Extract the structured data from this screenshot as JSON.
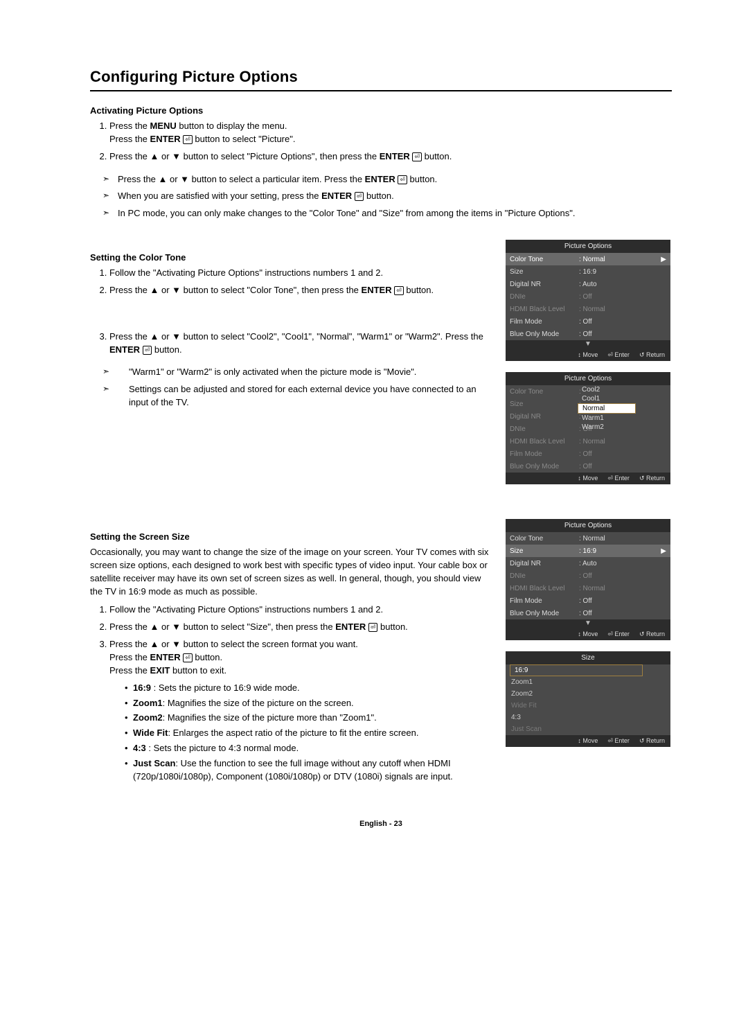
{
  "title": "Configuring Picture Options",
  "sec1": {
    "heading": "Activating Picture Options",
    "step1a": "Press the ",
    "step1b_bold": "MENU",
    "step1c": " button to display the menu.",
    "step1d": "Press the ",
    "step1e_bold": "ENTER",
    "step1f": " button to select \"Picture\".",
    "step2a": "Press the ▲ or ▼ button to select \"Picture Options\", then press the ",
    "step2b_bold": "ENTER",
    "step2c": " button.",
    "note1a": "Press the ▲ or ▼ button to select a particular item. Press the ",
    "note1b_bold": "ENTER",
    "note1c": " button.",
    "note2a": "When you are satisfied with your setting, press the ",
    "note2b_bold": "ENTER",
    "note2c": " button.",
    "note3": "In PC mode, you can only make changes to the \"Color Tone\" and \"Size\" from among the items in \"Picture Options\"."
  },
  "sec2": {
    "heading": "Setting the Color Tone",
    "step1": "Follow the \"Activating Picture Options\" instructions numbers 1 and 2.",
    "step2a": "Press the ▲ or ▼ button to select \"Color Tone\", then press the ",
    "step2b_bold": "ENTER",
    "step2c": " button.",
    "step3a": "Press the ▲ or ▼ button to select \"Cool2\", \"Cool1\", \"Normal\", \"Warm1\" or \"Warm2\". Press the ",
    "step3b_bold": "ENTER",
    "step3c": " button.",
    "note1": "\"Warm1\" or \"Warm2\" is only activated when the picture mode is \"Movie\".",
    "note2": "Settings can be adjusted and stored for each external device you have connected to an input of the TV."
  },
  "sec3": {
    "heading": "Setting the Screen Size",
    "intro": "Occasionally, you may want to change the size of the image on your screen. Your TV comes with six screen size options, each designed to work best with specific types of video input. Your cable box or satellite receiver may have its own set of screen sizes as well. In general, though, you should view the TV in 16:9 mode as much as possible.",
    "step1": "Follow the \"Activating Picture Options\" instructions numbers 1 and 2.",
    "step2a": "Press the ▲ or ▼ button to select \"Size\", then press the ",
    "step2b_bold": "ENTER",
    "step2c": " button.",
    "step3a": "Press the ▲ or ▼ button to select the screen format you want.",
    "step3b": "Press the ",
    "step3c_bold": "ENTER",
    "step3d": " button.",
    "step3e": "Press the ",
    "step3f_bold": "EXIT",
    "step3g": " button to exit.",
    "b1_bold": "16:9",
    "b1_rest": " : Sets the picture to 16:9 wide mode.",
    "b2_bold": "Zoom1",
    "b2_rest": ": Magnifies the size of the picture on the screen.",
    "b3_bold": "Zoom2",
    "b3_rest": ": Magnifies the size of the picture more than \"Zoom1\".",
    "b4_bold": "Wide Fit",
    "b4_rest": ": Enlarges the aspect ratio of the picture to fit the entire screen.",
    "b5_bold": "4:3",
    "b5_rest": " : Sets the picture to 4:3 normal mode.",
    "b6_bold": "Just Scan",
    "b6_rest": ": Use the function to see the full image without any cutoff when HDMI (720p/1080i/1080p), Component (1080i/1080p) or DTV (1080i) signals are input."
  },
  "osd1": {
    "title": "Picture Options",
    "rows": [
      {
        "lab": "Color Tone",
        "val": ": Normal",
        "hl": true,
        "arrow": "▶"
      },
      {
        "lab": "Size",
        "val": ": 16:9"
      },
      {
        "lab": "Digital NR",
        "val": ": Auto"
      },
      {
        "lab": "DNIe",
        "val": ": Off",
        "dim": true
      },
      {
        "lab": "HDMI Black Level",
        "val": ": Normal",
        "dim": true
      },
      {
        "lab": "Film Mode",
        "val": ": Off"
      },
      {
        "lab": "Blue Only Mode",
        "val": ": Off"
      }
    ],
    "more": "▼",
    "footer": {
      "move": "↕ Move",
      "enter": "⏎ Enter",
      "return": "↺ Return"
    }
  },
  "osd2": {
    "title": "Picture Options",
    "rows": [
      {
        "lab": "Color Tone",
        "val": ":",
        "dim": true
      },
      {
        "lab": "Size",
        "val": ":",
        "dim": true
      },
      {
        "lab": "Digital NR",
        "val": ":",
        "dim": true
      },
      {
        "lab": "DNIe",
        "val": ": Off",
        "dim": true
      },
      {
        "lab": "HDMI Black Level",
        "val": ": Normal",
        "dim": true
      },
      {
        "lab": "Film Mode",
        "val": ": Off",
        "dim": true
      },
      {
        "lab": "Blue Only Mode",
        "val": ": Off",
        "dim": true
      }
    ],
    "dropdown": [
      "Cool2",
      "Cool1",
      "Normal",
      "Warm1",
      "Warm2"
    ],
    "dropdown_sel": "Normal",
    "footer": {
      "move": "↕ Move",
      "enter": "⏎ Enter",
      "return": "↺ Return"
    }
  },
  "osd3": {
    "title": "Picture Options",
    "rows": [
      {
        "lab": "Color Tone",
        "val": ": Normal"
      },
      {
        "lab": "Size",
        "val": ": 16:9",
        "hl": true,
        "arrow": "▶"
      },
      {
        "lab": "Digital NR",
        "val": ": Auto"
      },
      {
        "lab": "DNIe",
        "val": ": Off",
        "dim": true
      },
      {
        "lab": "HDMI Black Level",
        "val": ": Normal",
        "dim": true
      },
      {
        "lab": "Film Mode",
        "val": ": Off"
      },
      {
        "lab": "Blue Only Mode",
        "val": ": Off"
      }
    ],
    "more": "▼",
    "footer": {
      "move": "↕ Move",
      "enter": "⏎ Enter",
      "return": "↺ Return"
    }
  },
  "osd4": {
    "title": "Size",
    "options": [
      "16:9",
      "Zoom1",
      "Zoom2",
      "Wide Fit",
      "4:3",
      "Just Scan"
    ],
    "sel": "16:9",
    "footer": {
      "move": "↕ Move",
      "enter": "⏎ Enter",
      "return": "↺ Return"
    }
  },
  "page_footer": "English - 23"
}
